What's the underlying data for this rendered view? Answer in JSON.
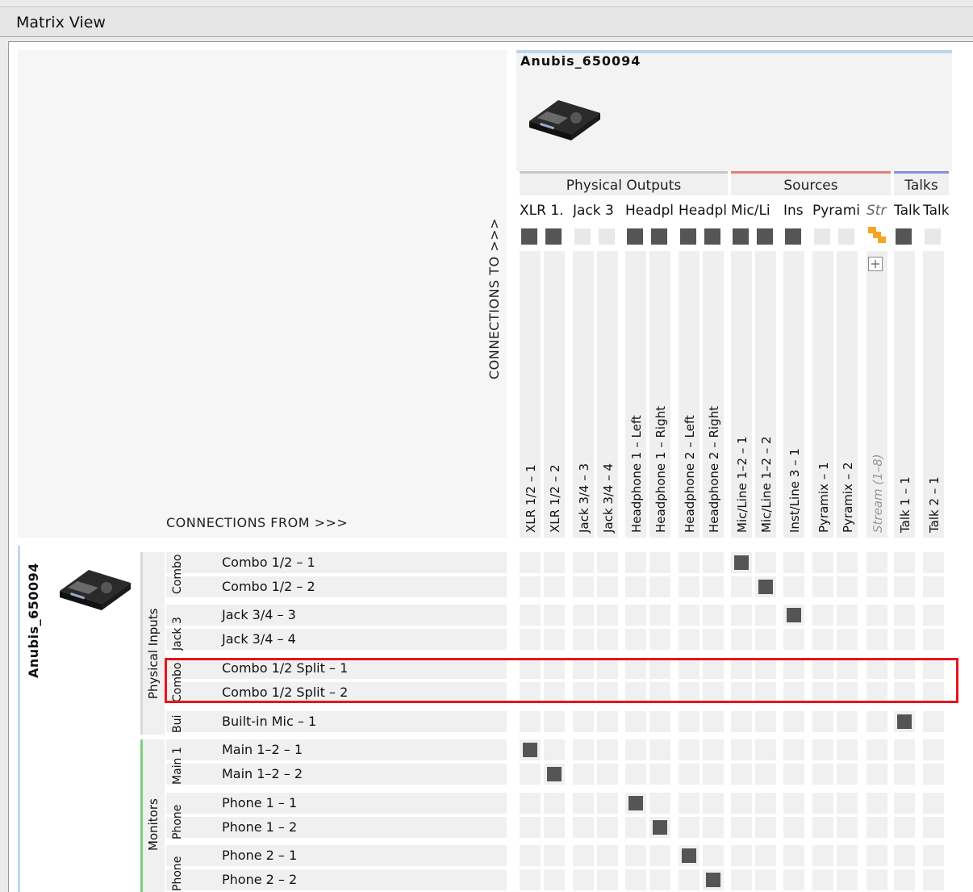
{
  "window": {
    "title": "Matrix View"
  },
  "labels": {
    "connections_from": "CONNECTIONS FROM >>>",
    "connections_to": "CONNECTIONS TO >>>"
  },
  "device": {
    "name": "Anubis_650094"
  },
  "column_groups": [
    {
      "label": "Physical Outputs",
      "color": "#c8c8c8"
    },
    {
      "label": "Sources",
      "color": "#e07e7e"
    },
    {
      "label": "Talks",
      "color": "#8c8cd8"
    }
  ],
  "column_headers": [
    "XLR 1.",
    "Jack 3",
    "Headpl",
    "Headpl",
    "Mic/Li",
    "Ins",
    "Pyrami",
    "Str",
    "Talk",
    "Talk"
  ],
  "columns": [
    {
      "label": "XLR 1/2 – 1",
      "active": true
    },
    {
      "label": "XLR 1/2 – 2",
      "active": true
    },
    {
      "label": "Jack 3/4 – 3",
      "active": false
    },
    {
      "label": "Jack 3/4 – 4",
      "active": false
    },
    {
      "label": "Headphone 1 – Left",
      "active": true
    },
    {
      "label": "Headphone 1 – Right",
      "active": true
    },
    {
      "label": "Headphone 2 – Left",
      "active": true
    },
    {
      "label": "Headphone 2 – Right",
      "active": true
    },
    {
      "label": "Mic/Line 1–2 – 1",
      "active": true
    },
    {
      "label": "Mic/Line 1–2 – 2",
      "active": true
    },
    {
      "label": "Inst/Line 3 – 1",
      "active": true
    },
    {
      "label": "Pyramix – 1",
      "active": false
    },
    {
      "label": "Pyramix – 2",
      "active": false
    },
    {
      "label": "Stream (1–8)",
      "active": false,
      "icon": "stream-icon"
    },
    {
      "label": "Talk 1 – 1",
      "active": true
    },
    {
      "label": "Talk 2 – 1",
      "active": false
    }
  ],
  "row_groups": [
    {
      "label": "Physical Inputs",
      "color": "#d8d8d8"
    },
    {
      "label": "Monitors",
      "color": "#7fd07f"
    }
  ],
  "row_subgroups": [
    "Combo",
    "Jack 3",
    "Combo",
    "Bui",
    "Main 1",
    "Phone",
    "Phone"
  ],
  "rows": [
    {
      "label": "Combo 1/2 – 1",
      "connected_col": 8
    },
    {
      "label": "Combo 1/2 – 2",
      "connected_col": 9
    },
    {
      "label": "Jack 3/4 – 3",
      "connected_col": 10
    },
    {
      "label": "Jack 3/4 – 4",
      "connected_col": null
    },
    {
      "label": "Combo 1/2 Split – 1",
      "connected_col": null
    },
    {
      "label": "Combo 1/2 Split – 2",
      "connected_col": null
    },
    {
      "label": "Built-in Mic – 1",
      "connected_col": 14
    },
    {
      "label": "Main 1–2 – 1",
      "connected_col": 0
    },
    {
      "label": "Main 1–2 – 2",
      "connected_col": 1
    },
    {
      "label": "Phone 1 – 1",
      "connected_col": 4
    },
    {
      "label": "Phone 1 – 2",
      "connected_col": 5
    },
    {
      "label": "Phone 2 – 1",
      "connected_col": 6
    },
    {
      "label": "Phone 2 – 2",
      "connected_col": 7
    }
  ],
  "colors": {
    "cell_on": "#555555",
    "cell_off": "#f0f0f0",
    "highlight": "#e8141c",
    "stream_orange": "#f5a623"
  }
}
